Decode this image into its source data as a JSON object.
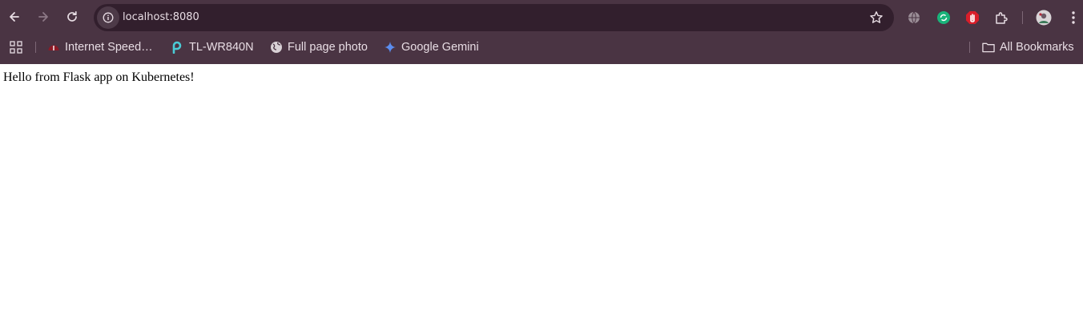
{
  "browser": {
    "address_bar": {
      "url": "localhost:8080"
    },
    "bookmarks": [
      {
        "label": "Internet Speed…",
        "icon": "speedometer-icon"
      },
      {
        "label": "TL-WR840N",
        "icon": "tplink-icon"
      },
      {
        "label": "Full page photo",
        "icon": "globe-icon"
      },
      {
        "label": "Google Gemini",
        "icon": "gemini-sparkle-icon"
      }
    ],
    "all_bookmarks_label": "All Bookmarks",
    "colors": {
      "frame": "#4a3443",
      "omnibox": "#321f2d",
      "text": "#e8dde4"
    }
  },
  "page": {
    "message": "Hello from Flask app on Kubernetes!"
  }
}
